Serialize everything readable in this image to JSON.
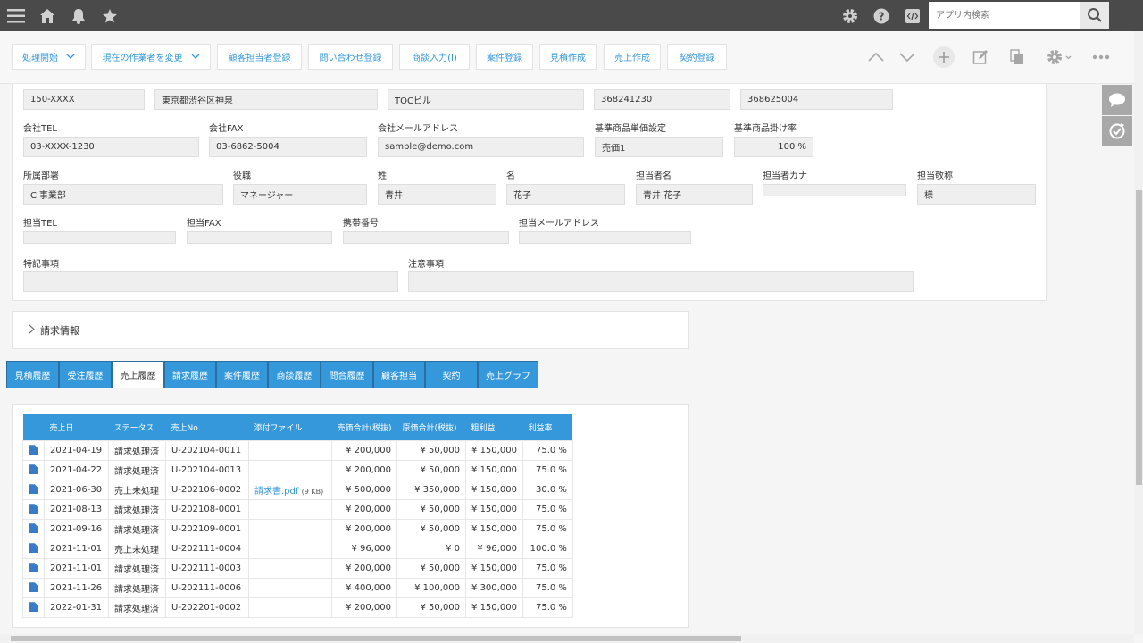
{
  "header": {
    "search_placeholder": "アプリ内検索",
    "icons": [
      "menu-icon",
      "home-icon",
      "bell-icon",
      "star-icon",
      "gear-icon",
      "help-icon",
      "code-icon",
      "search-icon"
    ]
  },
  "actions": {
    "buttons": [
      "処理開始",
      "現在の作業者を変更",
      "顧客担当者登録",
      "問い合わせ登録",
      "商談入力(I)",
      "案件登録",
      "見積作成",
      "売上作成",
      "契約登録"
    ],
    "right_icons": [
      "chevron-up-icon",
      "chevron-down-icon",
      "plus-icon",
      "edit-icon",
      "duplicate-icon",
      "settings-icon",
      "more-icon"
    ]
  },
  "form": {
    "row0": {
      "postal": "150-XXXX",
      "address": "東京都渋谷区神泉",
      "building": "TOCビル",
      "code1": "368241230",
      "code2": "368625004"
    },
    "row1": {
      "company_tel_label": "会社TEL",
      "company_tel": "03-XXXX-1230",
      "company_fax_label": "会社FAX",
      "company_fax": "03-6862-5004",
      "company_mail_label": "会社メールアドレス",
      "company_mail": "sample@demo.com",
      "price_setting_label": "基準商品単価設定",
      "price_setting": "売価1",
      "rate_label": "基準商品掛け率",
      "rate": "100 %"
    },
    "row2": {
      "dept_label": "所属部署",
      "dept": "CI事業部",
      "title_label": "役職",
      "title": "マネージャー",
      "last_label": "姓",
      "last": "青井",
      "first_label": "名",
      "first": "花子",
      "name_label": "担当者名",
      "name": "青井 花子",
      "kana_label": "担当者カナ",
      "kana": "",
      "honorific_label": "担当敬称",
      "honorific": "様"
    },
    "row3": {
      "tel_label": "担当TEL",
      "fax_label": "担当FAX",
      "mobile_label": "携帯番号",
      "mail_label": "担当メールアドレス"
    },
    "row4": {
      "special_label": "特記事項",
      "caution_label": "注意事項"
    }
  },
  "billing": {
    "label": "請求情報"
  },
  "tabs": [
    "見積履歴",
    "受注履歴",
    "売上履歴",
    "請求履歴",
    "案件履歴",
    "商談履歴",
    "問合履歴",
    "顧客担当",
    "契約",
    "売上グラフ"
  ],
  "active_tab": "売上履歴",
  "table": {
    "headers": [
      "売上日",
      "ステータス",
      "売上No.",
      "添付ファイル",
      "売価合計(税抜)",
      "原価合計(税抜)",
      "粗利益",
      "利益率"
    ],
    "rows": [
      {
        "date": "2021-04-19",
        "status": "請求処理済",
        "no": "U-202104-0011",
        "file": "",
        "size": "",
        "price": "¥ 200,000",
        "cost": "¥ 50,000",
        "profit": "¥ 150,000",
        "rate": "75.0 %"
      },
      {
        "date": "2021-04-22",
        "status": "請求処理済",
        "no": "U-202104-0013",
        "file": "",
        "size": "",
        "price": "¥ 200,000",
        "cost": "¥ 50,000",
        "profit": "¥ 150,000",
        "rate": "75.0 %"
      },
      {
        "date": "2021-06-30",
        "status": "売上未処理",
        "no": "U-202106-0002",
        "file": "請求書.pdf",
        "size": "(9 KB)",
        "price": "¥ 500,000",
        "cost": "¥ 350,000",
        "profit": "¥ 150,000",
        "rate": "30.0 %"
      },
      {
        "date": "2021-08-13",
        "status": "請求処理済",
        "no": "U-202108-0001",
        "file": "",
        "size": "",
        "price": "¥ 200,000",
        "cost": "¥ 50,000",
        "profit": "¥ 150,000",
        "rate": "75.0 %"
      },
      {
        "date": "2021-09-16",
        "status": "請求処理済",
        "no": "U-202109-0001",
        "file": "",
        "size": "",
        "price": "¥ 200,000",
        "cost": "¥ 50,000",
        "profit": "¥ 150,000",
        "rate": "75.0 %"
      },
      {
        "date": "2021-11-01",
        "status": "売上未処理",
        "no": "U-202111-0004",
        "file": "",
        "size": "",
        "price": "¥ 96,000",
        "cost": "¥ 0",
        "profit": "¥ 96,000",
        "rate": "100.0 %"
      },
      {
        "date": "2021-11-01",
        "status": "請求処理済",
        "no": "U-202111-0003",
        "file": "",
        "size": "",
        "price": "¥ 200,000",
        "cost": "¥ 50,000",
        "profit": "¥ 150,000",
        "rate": "75.0 %"
      },
      {
        "date": "2021-11-26",
        "status": "請求処理済",
        "no": "U-202111-0006",
        "file": "",
        "size": "",
        "price": "¥ 400,000",
        "cost": "¥ 100,000",
        "profit": "¥ 300,000",
        "rate": "75.0 %"
      },
      {
        "date": "2022-01-31",
        "status": "請求処理済",
        "no": "U-202201-0002",
        "file": "",
        "size": "",
        "price": "¥ 200,000",
        "cost": "¥ 50,000",
        "profit": "¥ 150,000",
        "rate": "75.0 %"
      }
    ]
  },
  "side_icons": [
    "comment-icon",
    "history-icon"
  ]
}
